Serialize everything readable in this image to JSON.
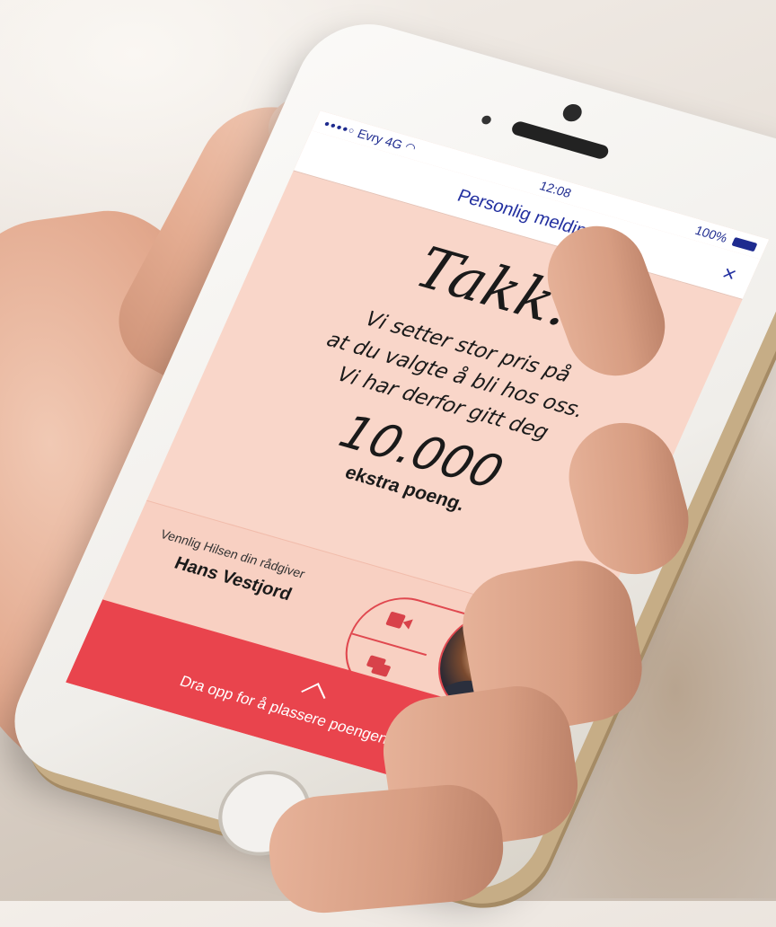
{
  "status_bar": {
    "carrier": "Evry 4G",
    "time": "12:08",
    "battery": "100%"
  },
  "nav": {
    "title": "Personlig melding",
    "close_glyph": "×"
  },
  "message": {
    "title": "Takk.",
    "lines": [
      "Vi setter stor pris på",
      "at du valgte å bli hos oss.",
      "Vi har derfor gitt deg"
    ],
    "points_value": "10.000",
    "points_label": "ekstra poeng."
  },
  "advisor": {
    "greeting": "Vennlig Hilsen din rådgiver",
    "name": "Hans Vestjord",
    "actions": [
      "video-icon",
      "chat-icon"
    ]
  },
  "bottom_bar": {
    "cta": "Dra opp for å plassere poengene dine"
  },
  "colors": {
    "accent_red": "#e9444d",
    "screen_bg": "#f9d6c9",
    "nav_blue": "#2330a0"
  }
}
